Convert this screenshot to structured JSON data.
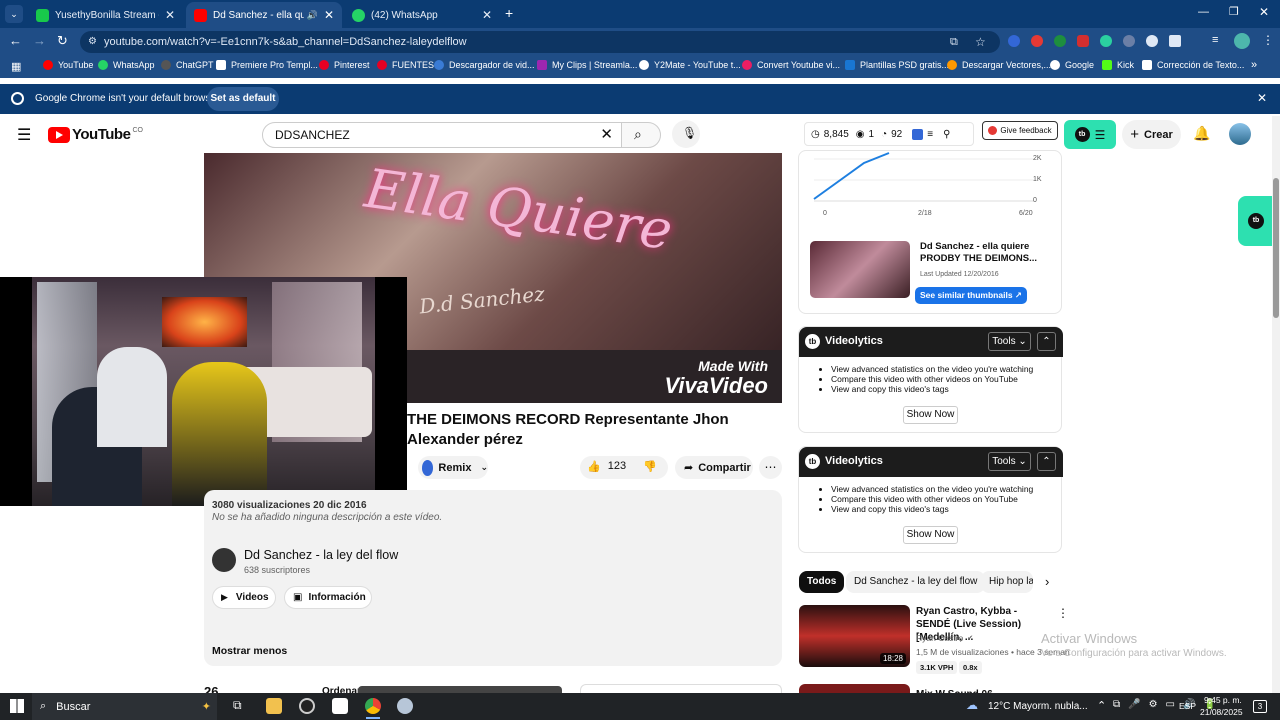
{
  "tabs": [
    {
      "title": "YusethyBonilla Stream - Watch",
      "color": "#18c94b"
    },
    {
      "title": "Dd Sanchez - ella quiere PR",
      "color": "#ff0000"
    },
    {
      "title": "(42) WhatsApp",
      "color": "#25d366"
    }
  ],
  "url": "youtube.com/watch?v=-Ee1cnn7k-s&ab_channel=DdSanchez-laleydelflow",
  "bookmarks": [
    "YouTube",
    "WhatsApp",
    "ChatGPT",
    "Premiere Pro Templ...",
    "Pinterest",
    "FUENTES",
    "Descargador de vid...",
    "My Clips | Streamla...",
    "Y2Mate - YouTube t...",
    "Convert Youtube vi...",
    "Plantillas PSD gratis...",
    "Descargar Vectores,...",
    "Google",
    "Kick",
    "Corrección de Texto..."
  ],
  "infobar": {
    "message": "Google Chrome isn't your default browser",
    "button": "Set as default"
  },
  "yt": {
    "logo": "YouTube",
    "country": "CO",
    "search_value": "DDSANCHEZ",
    "stats": {
      "views": "8,845",
      "viewers": "1",
      "score": "92"
    },
    "feedback": "Give feedback",
    "create": "Crear"
  },
  "video": {
    "thumb_title": "Ella Quiere",
    "thumb_signature": "D.d Sanchez",
    "made_with": "Made With",
    "vivavideo": "VivaVideo",
    "title": "THE DEIMONS RECORD Representante Jhon Alexander pérez",
    "remix": "Remix",
    "likes": "123",
    "share": "Compartir",
    "views_date": "3080 visualizaciones  20 dic 2016",
    "no_desc": "No se ha añadido ninguna descripción a este vídeo.",
    "channel": "Dd Sanchez - la ley del flow",
    "subs": "638 suscriptores",
    "videos_btn": "Videos",
    "info_btn": "Información",
    "show_less": "Mostrar menos",
    "comments_count": "26",
    "order": "Ordenar"
  },
  "sidebar": {
    "chart_y": [
      "2K",
      "1K",
      "0"
    ],
    "chart_x": [
      "0",
      "2/18",
      "6/20"
    ],
    "similar": {
      "title": "Dd Sanchez - ella quiere PRODBY THE DEIMONS...",
      "updated": "Last Updated 12/20/2016",
      "button": "See similar thumbnails ↗"
    },
    "videolytics": {
      "name": "Videolytics",
      "tools": "Tools",
      "show": "Show Now",
      "items": [
        "View advanced statistics on the video you're watching",
        "Compare this video with other videos on YouTube",
        "View and copy this video's tags"
      ]
    },
    "chips": [
      "Todos",
      "Dd Sanchez - la ley del flow",
      "Hip hop la"
    ],
    "rec": {
      "title": "Ryan Castro, Kybba - SENDÉ (Live Session) [Medellín, ...",
      "channel": "Ryan Castro",
      "meta": "1,5 M de visualizaciones • hace 3 seman",
      "duration": "18:28",
      "vph": "3.1K VPH",
      "ratio": "0.8x",
      "next_title": "Mix W Sound 06"
    }
  },
  "windows": {
    "activate": "Activar Windows",
    "activate_sub": "Ve a Configuración para activar Windows.",
    "search": "Buscar",
    "weather": "12°C  Mayorm. nubla...",
    "lang": "ESP",
    "time": "9:45 p. m.",
    "date": "21/08/2025",
    "notifications": "3"
  }
}
